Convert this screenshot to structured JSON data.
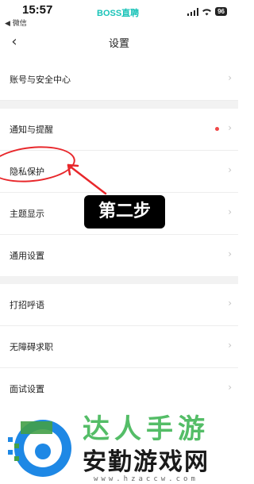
{
  "status_bar": {
    "time": "15:57",
    "back_app": "◀ 微信",
    "brand": "BOSS直聘",
    "battery": "96"
  },
  "nav": {
    "title": "设置"
  },
  "settings": {
    "items": [
      {
        "label": "账号与安全中心"
      },
      {
        "label": "通知与提醒"
      },
      {
        "label": "隐私保护"
      },
      {
        "label": "主题显示"
      },
      {
        "label": "通用设置"
      },
      {
        "label": "打招呼语"
      },
      {
        "label": "无障碍求职"
      },
      {
        "label": "面试设置"
      }
    ]
  },
  "annotation": {
    "step_text": "第二步",
    "accent_color": "#e8272b"
  },
  "watermark": {
    "top_text": "达人手游",
    "main_text": "安勤游戏网",
    "url": "www.hzaccw.com"
  }
}
